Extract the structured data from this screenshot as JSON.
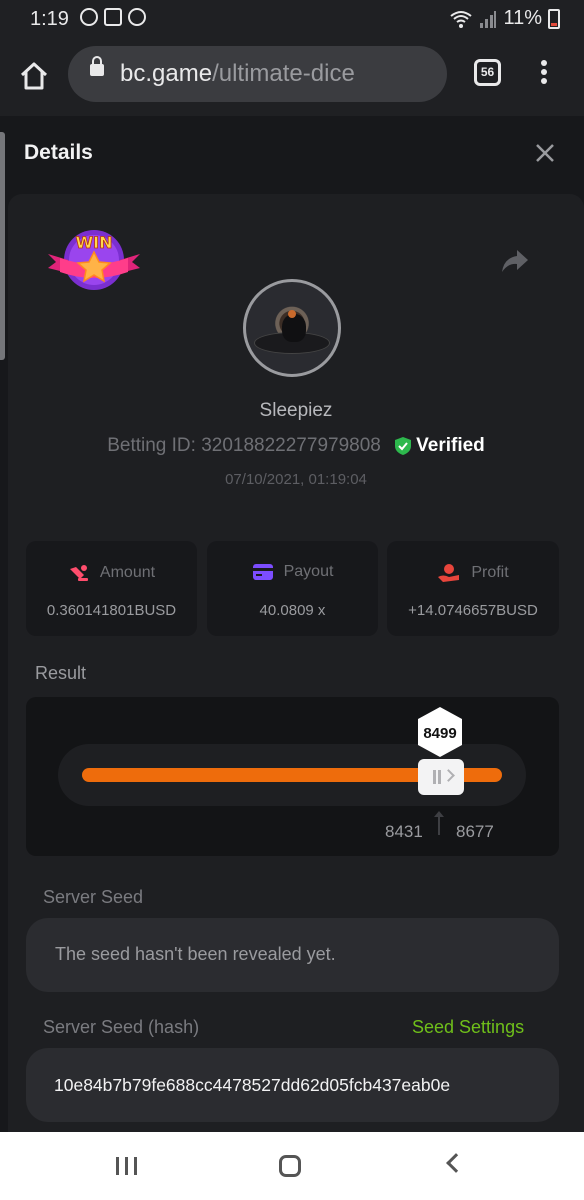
{
  "status_bar": {
    "time": "1:19",
    "battery": "11%"
  },
  "browser": {
    "url_domain": "bc.game",
    "url_path": "/ultimate-dice",
    "tab_count": "56"
  },
  "details": {
    "title": "Details",
    "username": "Sleepiez",
    "betting_id_label": "Betting ID:",
    "betting_id": "32018822277979808",
    "verified": "Verified",
    "datetime": "07/10/2021, 01:19:04",
    "badge_text": "WIN"
  },
  "stats": {
    "amount_label": "Amount",
    "amount_value": "0.360141801BUSD",
    "payout_label": "Payout",
    "payout_value": "40.0809 x",
    "profit_label": "Profit",
    "profit_value": "+14.0746657BUSD"
  },
  "result": {
    "label": "Result",
    "roll": "8499",
    "range_low": "8431",
    "range_high": "8677"
  },
  "seeds": {
    "server_seed_label": "Server Seed",
    "server_seed_value": "The seed hasn't been revealed yet.",
    "server_seed_hash_label": "Server Seed (hash)",
    "seed_settings_label": "Seed Settings",
    "server_seed_hash_value": "10e84b7b79fe688cc4478527dd62d05fcb437eab0e"
  },
  "colors": {
    "accent_orange": "#ee6c0c",
    "verified_green": "#2db84d",
    "link_green": "#6fbf1a",
    "icon_pink": "#ff4d6d",
    "icon_purple": "#7c4dff",
    "icon_red": "#e8453c"
  }
}
